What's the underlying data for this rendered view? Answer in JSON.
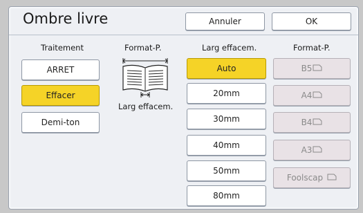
{
  "dialog": {
    "title": "Ombre livre",
    "cancel_label": "Annuler",
    "ok_label": "OK"
  },
  "traitement": {
    "heading": "Traitement",
    "options": [
      "ARRET",
      "Effacer",
      "Demi-ton"
    ],
    "selected": "Effacer"
  },
  "format_illustration": {
    "heading": "Format-P.",
    "caption": "Larg effacem."
  },
  "larg_effacem": {
    "heading": "Larg effacem.",
    "options": [
      "Auto",
      "20mm",
      "30mm",
      "40mm",
      "50mm",
      "80mm"
    ],
    "selected": "Auto"
  },
  "format_p": {
    "heading": "Format-P.",
    "options": [
      "B5",
      "A4",
      "B4",
      "A3",
      "Foolscap"
    ],
    "icon": "landscape-paper-icon"
  },
  "colors": {
    "selected": "#f5d327",
    "panel": "#eef0f4",
    "disabled": "#e9e2e6"
  }
}
